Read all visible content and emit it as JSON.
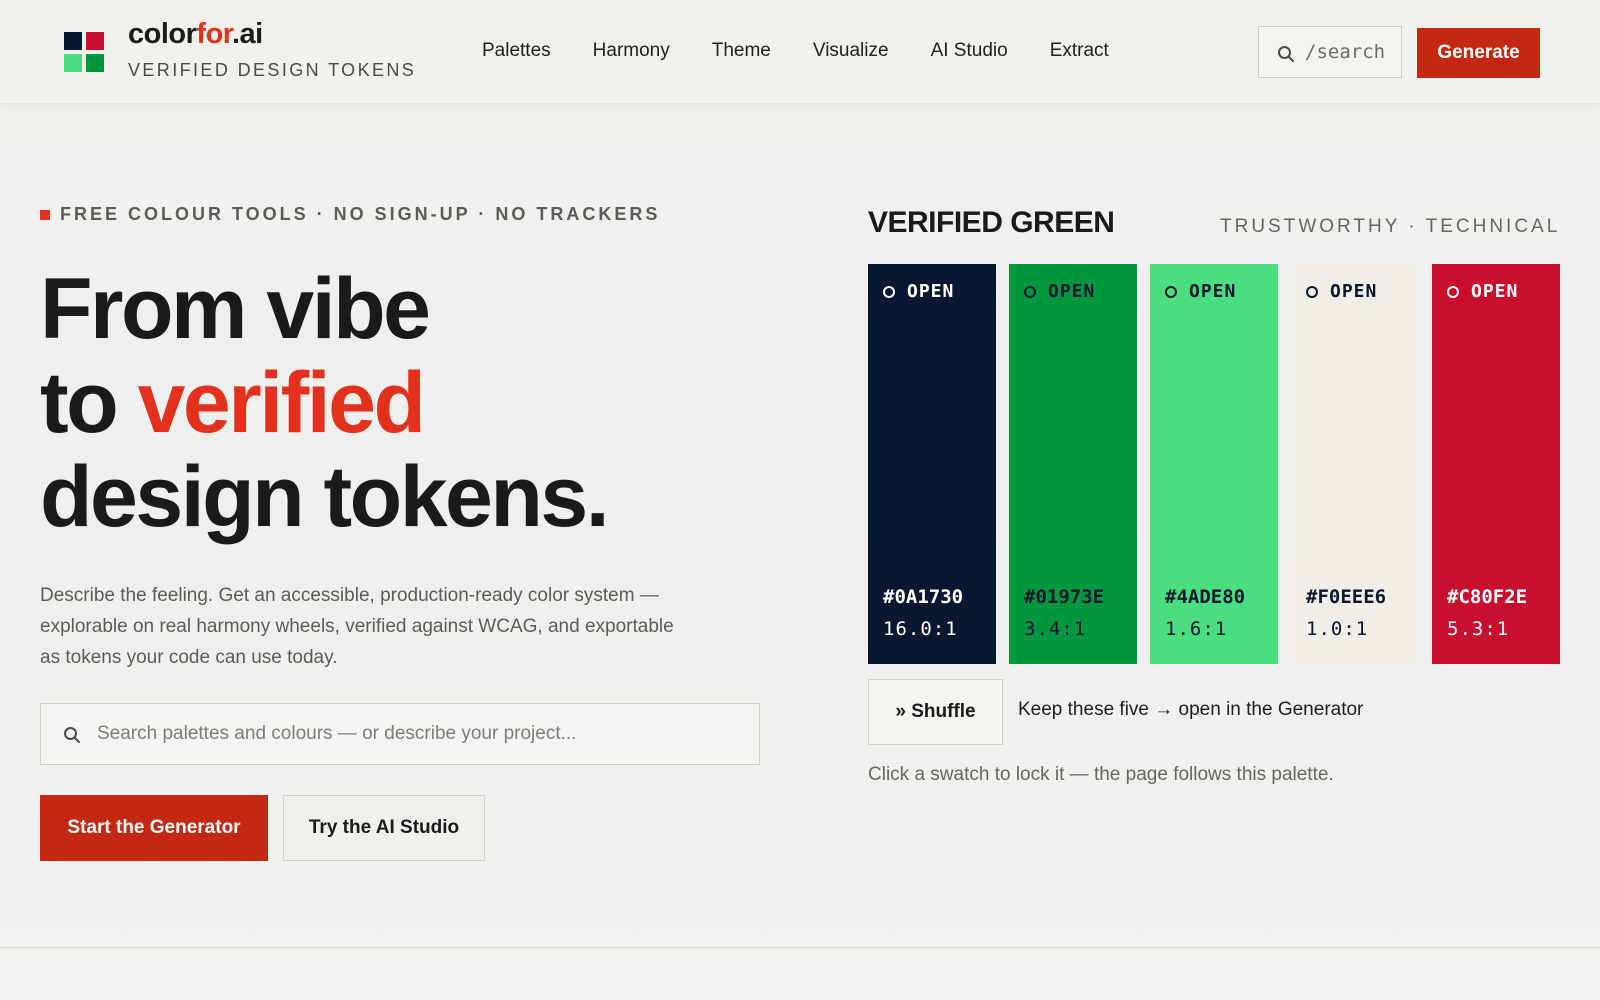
{
  "colors": {
    "accent": "#E2311D",
    "primary_button": "#C42812",
    "logo": [
      "#0A1730",
      "#C80F2E",
      "#4ADE80",
      "#01973E"
    ]
  },
  "header": {
    "brand_part1": "color",
    "brand_part2": "for",
    "brand_part3": ".ai",
    "brand_subtitle": "VERIFIED DESIGN TOKENS",
    "nav": [
      "Palettes",
      "Harmony",
      "Theme",
      "Visualize",
      "AI Studio",
      "Extract"
    ],
    "search_placeholder": "/search",
    "generate_label": "Generate"
  },
  "hero": {
    "eyebrow": "FREE COLOUR TOOLS · NO SIGN-UP · NO TRACKERS",
    "headline_line1": "From vibe",
    "headline_line2_a": "to ",
    "headline_line2_b": "verified",
    "headline_line3": "design tokens.",
    "lead": "Describe the feeling. Get an accessible, production-ready color system — explorable on real harmony wheels, verified against WCAG, and exportable as tokens your code can use today.",
    "search_placeholder": "Search palettes and colours — or describe your project...",
    "primary_cta": "Start the Generator",
    "secondary_cta": "Try the AI Studio"
  },
  "palette": {
    "title": "VERIFIED GREEN",
    "tags": "TRUSTWORTHY · TECHNICAL",
    "swatches": [
      {
        "label": "OPEN",
        "hex": "#0A1730",
        "ratio": "16.0:1",
        "bg": "#0A1730",
        "fg": "#FFFFFF"
      },
      {
        "label": "OPEN",
        "hex": "#01973E",
        "ratio": "3.4:1",
        "bg": "#01973E",
        "fg": "#0A1730"
      },
      {
        "label": "OPEN",
        "hex": "#4ADE80",
        "ratio": "1.6:1",
        "bg": "#4ADE80",
        "fg": "#0A1730"
      },
      {
        "label": "OPEN",
        "hex": "#F0EEE6",
        "ratio": "1.0:1",
        "bg": "#F0EEE6",
        "fg": "#0A1730"
      },
      {
        "label": "OPEN",
        "hex": "#C80F2E",
        "ratio": "5.3:1",
        "bg": "#C80F2E",
        "fg": "#FFFFFF"
      }
    ],
    "shuffle_label": "» Shuffle",
    "keep_label": "Keep these five → open in the Generator",
    "hint": "Click a swatch to lock it — the page follows this palette."
  }
}
